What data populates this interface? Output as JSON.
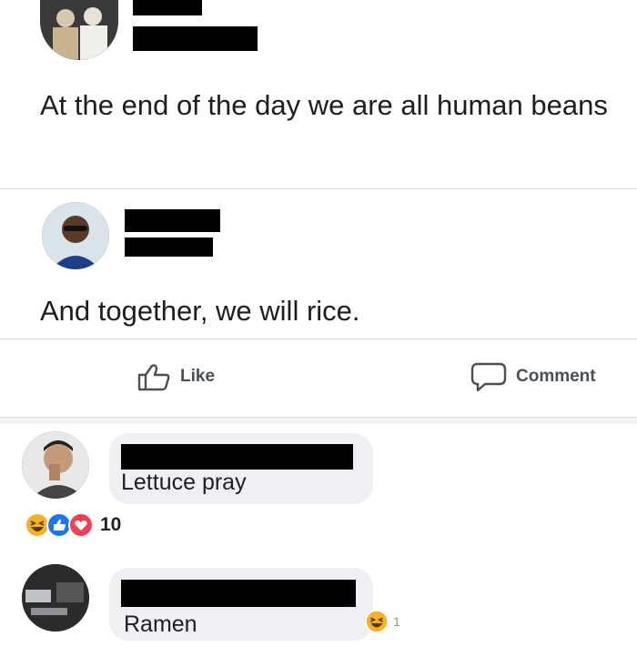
{
  "posts": [
    {
      "text": "At the end of the day we are all human beans"
    },
    {
      "text": "And together, we will rice."
    }
  ],
  "actions": {
    "like_label": "Like",
    "comment_label": "Comment"
  },
  "comments": [
    {
      "text": "Lettuce pray",
      "reaction_count": "10",
      "reactions": [
        "haha-icon",
        "like-icon",
        "love-icon"
      ]
    },
    {
      "text": "Ramen",
      "reaction_count": "1",
      "reactions": [
        "haha-icon"
      ]
    }
  ],
  "colors": {
    "like_blue": "#1877f2",
    "love_red": "#f33e58",
    "haha_yellow": "#f7b125",
    "bubble": "#eef0f3"
  }
}
